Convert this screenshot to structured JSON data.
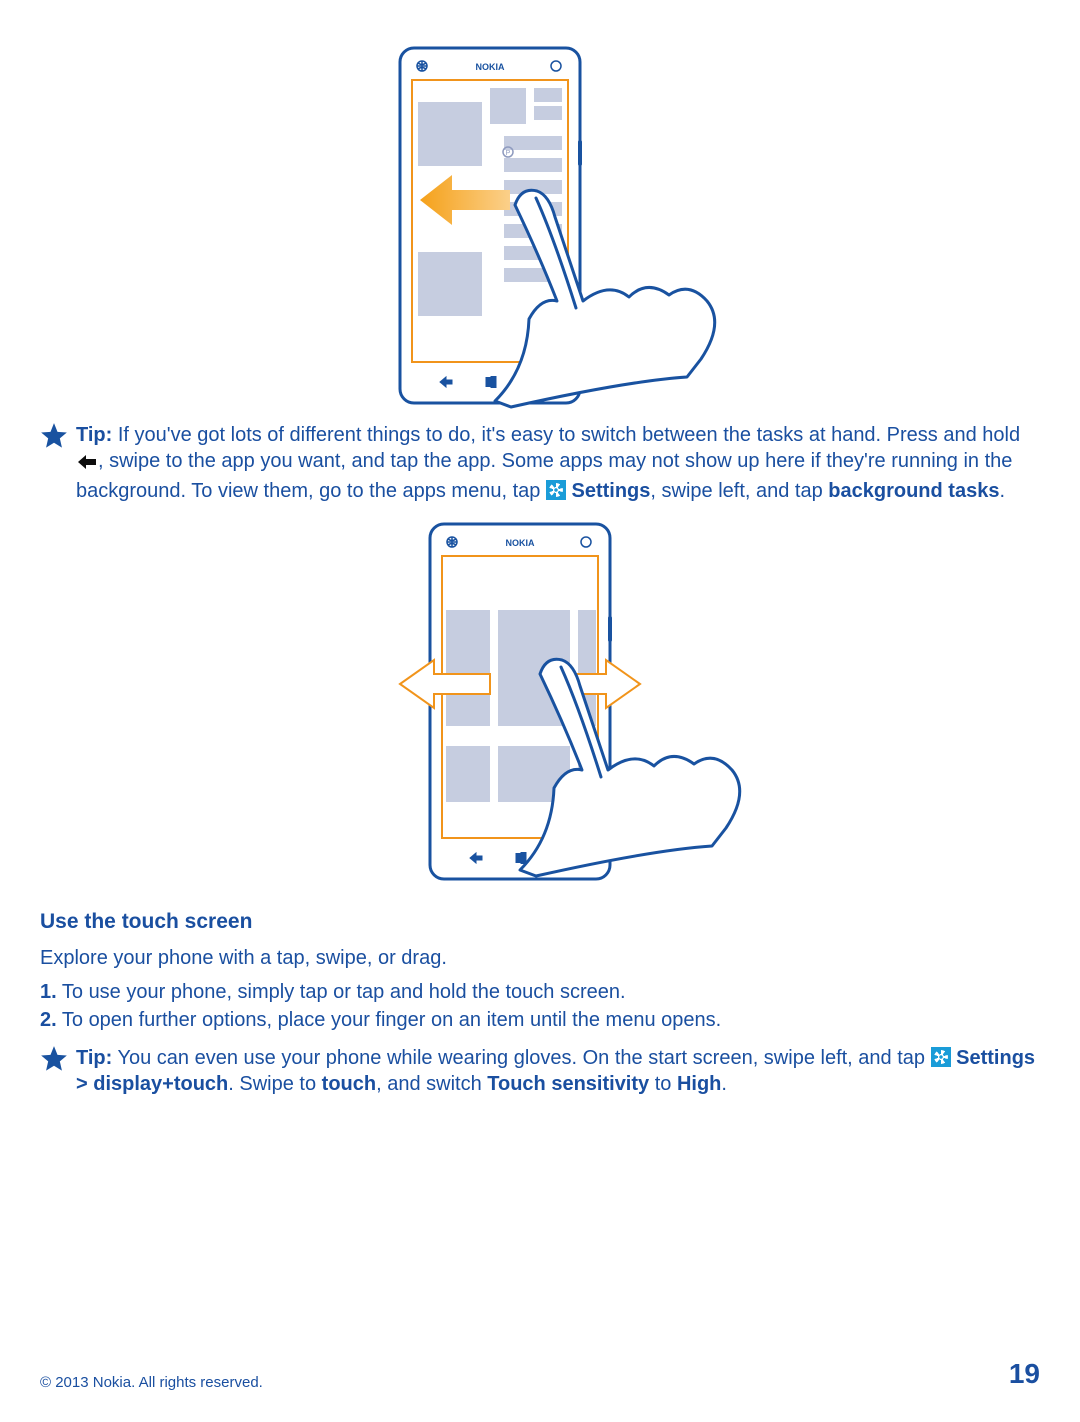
{
  "phone_brand": "NOKIA",
  "tip1": {
    "label": "Tip:",
    "text_a": " If you've got lots of different things to do, it's easy to switch between the tasks at hand. Press and hold ",
    "text_b": ", swipe to the app you want, and tap the app. Some apps may not show up here if they're running in the background. To view them, go to the apps menu, tap ",
    "settings": "Settings",
    "text_c": ", swipe left, and tap ",
    "bold2": "background tasks",
    "text_d": "."
  },
  "section_title": "Use the touch screen",
  "intro": "Explore your phone with a tap, swipe, or drag.",
  "step1_num": "1.",
  "step1": " To use your phone, simply tap or tap and hold the touch screen.",
  "step2_num": "2.",
  "step2": " To open further options, place your finger on an item until the menu opens.",
  "tip2": {
    "label": "Tip:",
    "text_a": " You can even use your phone while wearing gloves. On the start screen, swipe left, and tap ",
    "settings_path": "Settings > display+touch",
    "text_b": ". Swipe to ",
    "bold2": "touch",
    "text_c": ", and switch ",
    "bold3": "Touch sensitivity",
    "text_d": " to ",
    "bold4": "High",
    "text_e": "."
  },
  "copyright": "© 2013 Nokia. All rights reserved.",
  "page_number": "19"
}
